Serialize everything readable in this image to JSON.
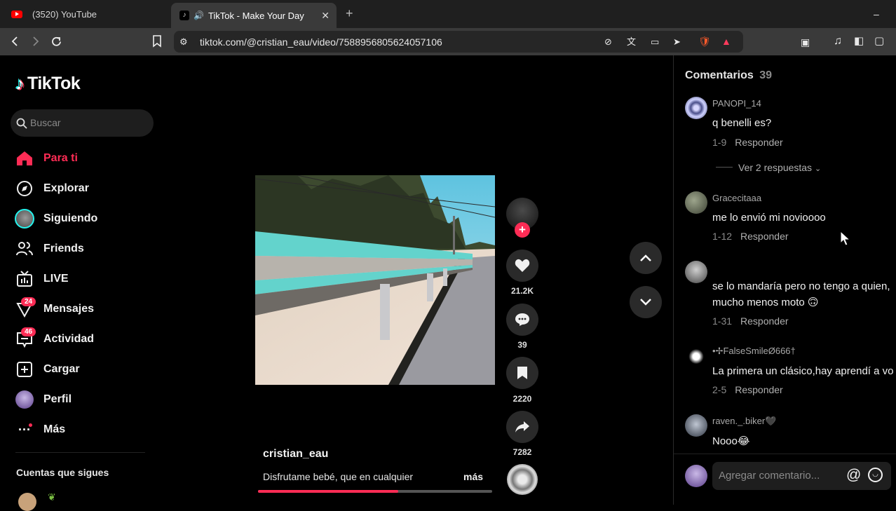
{
  "browser": {
    "tabs": [
      {
        "title": "(3520) YouTube",
        "icon": "youtube-icon"
      },
      {
        "title": "TikTok - Make Your Day",
        "icon": "tiktok-icon"
      }
    ],
    "url": "tiktok.com/@cristian_eau/video/7588956805624057106"
  },
  "sidebar": {
    "logo": "TikTok",
    "search_placeholder": "Buscar",
    "items": [
      {
        "label": "Para ti",
        "icon": "home-icon"
      },
      {
        "label": "Explorar",
        "icon": "compass-icon"
      },
      {
        "label": "Siguiendo",
        "icon": "following-avatar-icon"
      },
      {
        "label": "Friends",
        "icon": "friends-icon"
      },
      {
        "label": "LIVE",
        "icon": "live-icon"
      },
      {
        "label": "Mensajes",
        "icon": "messages-icon",
        "badge": "24"
      },
      {
        "label": "Actividad",
        "icon": "activity-icon",
        "badge": "46"
      },
      {
        "label": "Cargar",
        "icon": "upload-icon"
      },
      {
        "label": "Perfil",
        "icon": "profile-avatar-icon"
      },
      {
        "label": "Más",
        "icon": "more-icon"
      }
    ],
    "following_title": "Cuentas que sigues"
  },
  "video": {
    "author": "cristian_eau",
    "caption": "Disfrutame bebé, que en cualquier",
    "more_label": "más",
    "progress_fraction": 0.6,
    "likes": "21.2K",
    "comments": "39",
    "saves": "2220",
    "shares": "7282"
  },
  "comments_panel": {
    "title": "Comentarios",
    "count": "39",
    "reply_label": "Responder",
    "view_replies": "Ver 2 respuestas",
    "add_placeholder": "Agregar comentario...",
    "comments": [
      {
        "user": "PANOPI_14",
        "text": "q benelli es?",
        "date": "1-9"
      },
      {
        "user": "Gracecitaaa",
        "text": "me lo envió mi novioooo",
        "date": "1-12"
      },
      {
        "user": "",
        "text": "se lo mandaría pero no tengo a quien,",
        "text2": "mucho menos moto 🙃",
        "date": "1-31"
      },
      {
        "user": "•✢FalseSmileØ666†",
        "text": "La primera un clásico,hay aprendí a vo",
        "date": "2-5"
      },
      {
        "user": "raven._.biker🖤",
        "text": "Nooo😂",
        "date": ""
      }
    ]
  },
  "colors": {
    "accent": "#fe2c55",
    "background": "#000000",
    "chrome": "#3a3a3a"
  }
}
